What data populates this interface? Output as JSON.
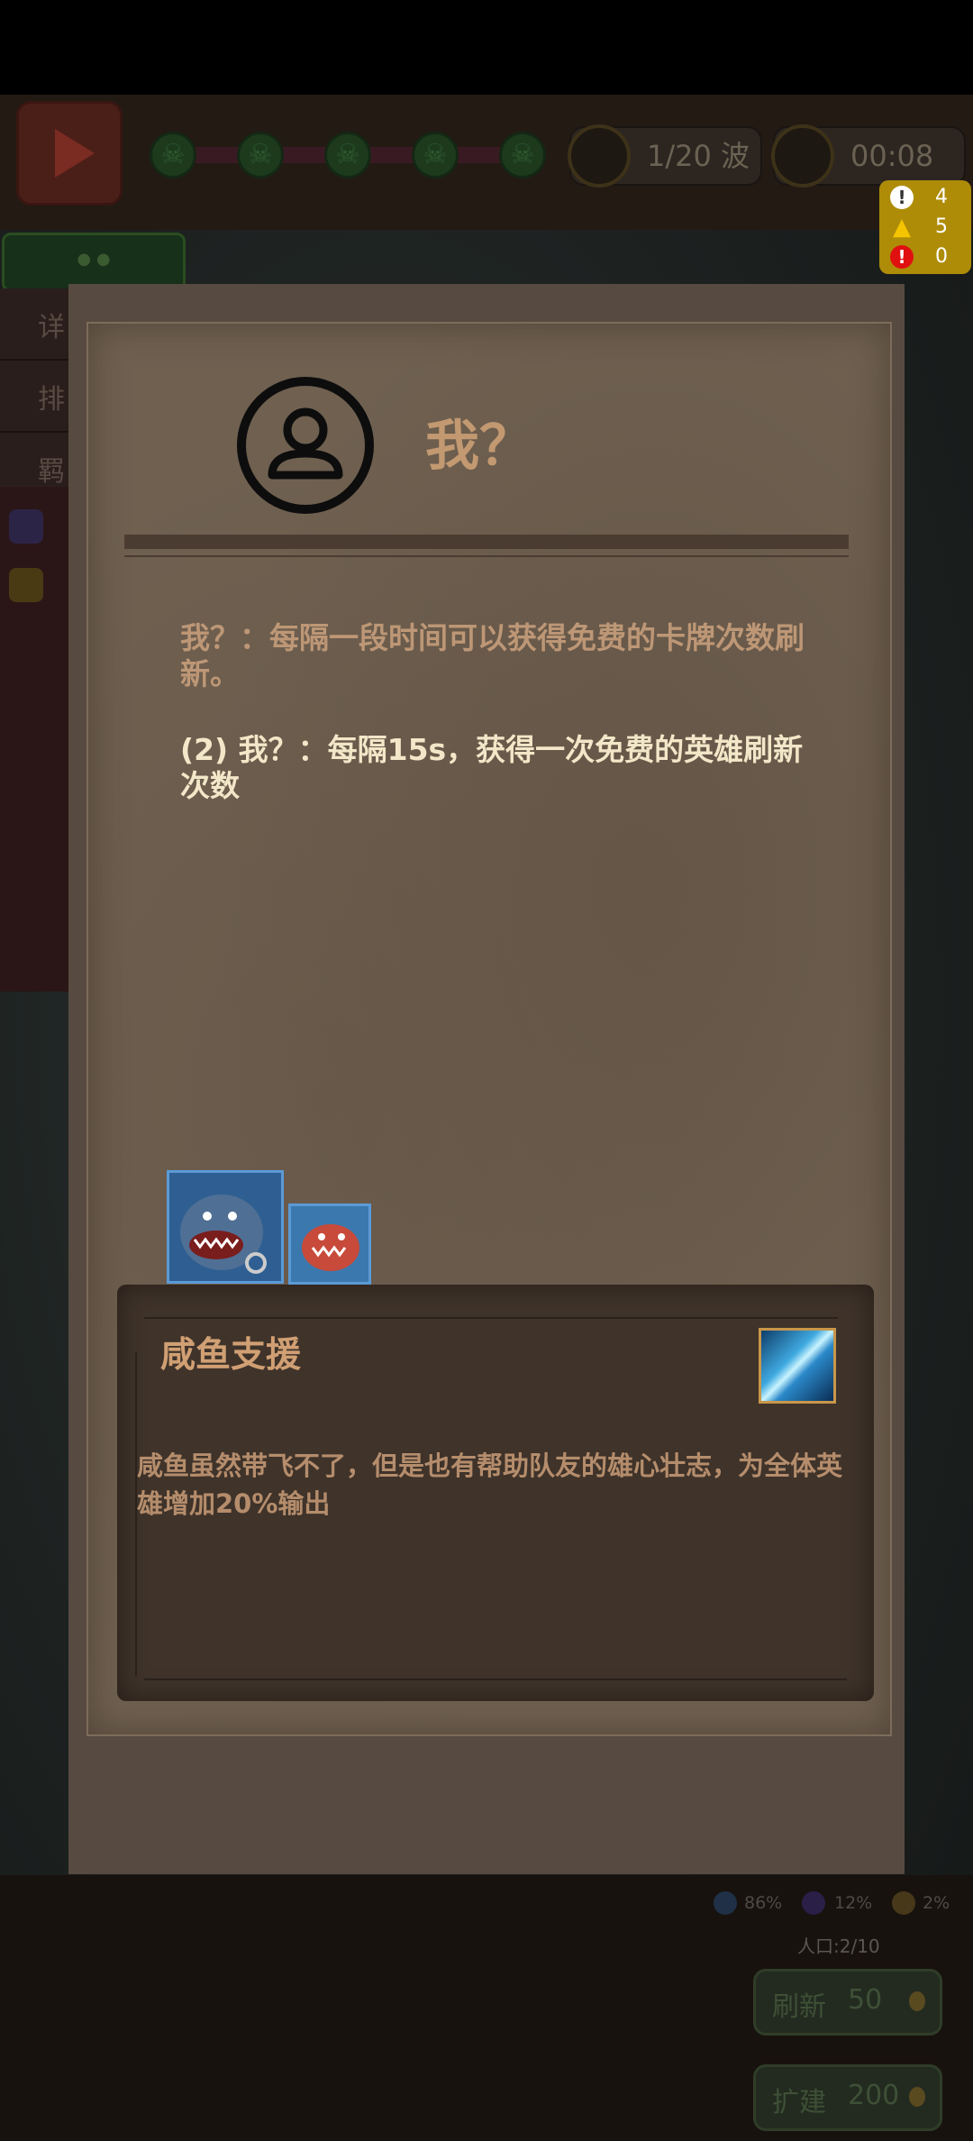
{
  "hud": {
    "wave_text": "1/20 波",
    "timer": "00:08"
  },
  "warnings": [
    {
      "icon": "info-icon",
      "value": "4",
      "color": "#ffffff"
    },
    {
      "icon": "caution-triangle-icon",
      "value": "5",
      "color": "#f5c400"
    },
    {
      "icon": "error-icon",
      "value": "0",
      "color": "#e01010"
    }
  ],
  "side_tabs": [
    "详",
    "排",
    "羁"
  ],
  "dialog": {
    "title": "我？",
    "description_1": "我？：每隔一段时间可以获得免费的卡牌次数刷新。",
    "description_2": "(2) 我？：每隔15s，获得一次免费的英雄刷新次数"
  },
  "skill": {
    "name": "咸鱼支援",
    "description": "咸鱼虽然带飞不了，但是也有帮助队友的雄心壮志，为全体英雄增加20%输出"
  },
  "bottom": {
    "percent_1": "86%",
    "percent_2": "12%",
    "percent_3": "2%",
    "population": "人口:2/10",
    "refresh_label": "刷新",
    "refresh_cost": "50",
    "expand_label": "扩建",
    "expand_cost": "200"
  },
  "colors": {
    "dialog_title": "#c39971",
    "desc_primary": "#bd9776",
    "desc_highlight": "#f2e7c8",
    "warning_panel": "#ae8c08"
  }
}
